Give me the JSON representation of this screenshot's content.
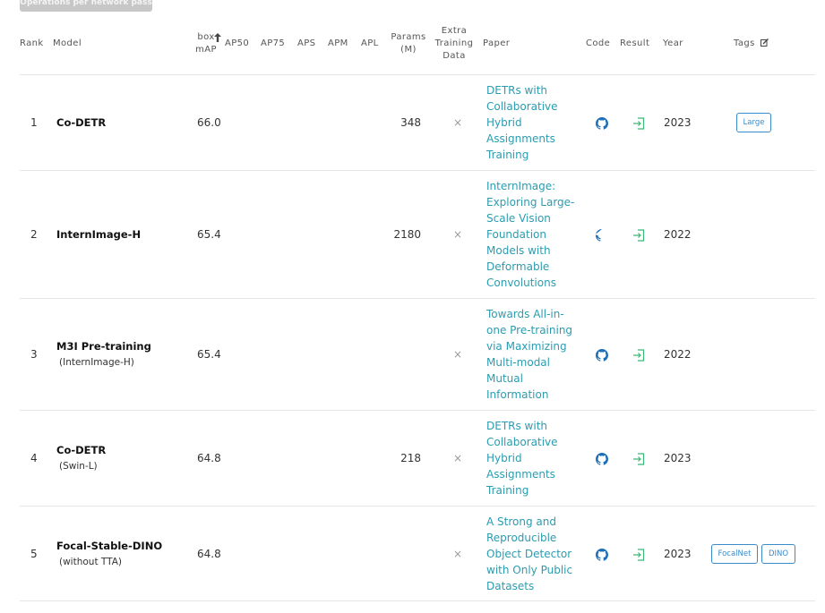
{
  "top_pill": "Operations per network pass",
  "header": {
    "rank": "Rank",
    "model": "Model",
    "box_map_line1": "box",
    "box_map_line2": "mAP",
    "ap50": "AP50",
    "ap75": "AP75",
    "aps": "APS",
    "apm": "APM",
    "apl": "APL",
    "params_line1": "Params",
    "params_line2": "(M)",
    "extra_line1": "Extra",
    "extra_line2": "Training",
    "extra_line3": "Data",
    "paper": "Paper",
    "code": "Code",
    "result": "Result",
    "year": "Year",
    "tags": "Tags"
  },
  "rows": [
    {
      "rank": "1",
      "model": "Co-DETR",
      "model_sub": "",
      "box_map": "66.0",
      "params": "348",
      "extra": "×",
      "paper_lines": [
        "DETRs with",
        "Collaborative",
        "Hybrid",
        "Assignments",
        "Training"
      ],
      "year": "2023",
      "tags": [
        "Large"
      ]
    },
    {
      "rank": "2",
      "model": "InternImage-H",
      "model_sub": "",
      "box_map": "65.4",
      "params": "2180",
      "extra": "×",
      "paper_lines": [
        "InternImage:",
        "Exploring Large-",
        "Scale Vision",
        "Foundation",
        "Models with",
        "Deformable",
        "Convolutions"
      ],
      "year": "2022",
      "tags": []
    },
    {
      "rank": "3",
      "model": "M3I Pre-training",
      "model_sub": "(InternImage-H)",
      "box_map": "65.4",
      "params": "",
      "extra": "×",
      "paper_lines": [
        "Towards All-in-",
        "one Pre-training",
        "via Maximizing",
        "Multi-modal",
        "Mutual",
        "Information"
      ],
      "year": "2022",
      "tags": []
    },
    {
      "rank": "4",
      "model": "Co-DETR",
      "model_sub": "(Swin-L)",
      "box_map": "64.8",
      "params": "218",
      "extra": "×",
      "paper_lines": [
        "DETRs with",
        "Collaborative",
        "Hybrid",
        "Assignments",
        "Training"
      ],
      "year": "2023",
      "tags": []
    },
    {
      "rank": "5",
      "model": "Focal-Stable-DINO",
      "model_sub": "(without TTA)",
      "box_map": "64.8",
      "params": "",
      "extra": "×",
      "paper_lines": [
        "A Strong and",
        "Reproducible",
        "Object Detector",
        "with Only Public",
        "Datasets"
      ],
      "year": "2023",
      "tags": [
        "FocalNet",
        "DINO"
      ]
    }
  ],
  "icons": {
    "sort": "arrow-up-icon",
    "edit": "edit-icon",
    "code": "github-icon",
    "result": "result-enter-icon"
  },
  "colors": {
    "paper_link": "#2b9cb0",
    "tag_border": "#3a8bc9",
    "github": "#1e6fb8",
    "result": "#3cb878"
  }
}
